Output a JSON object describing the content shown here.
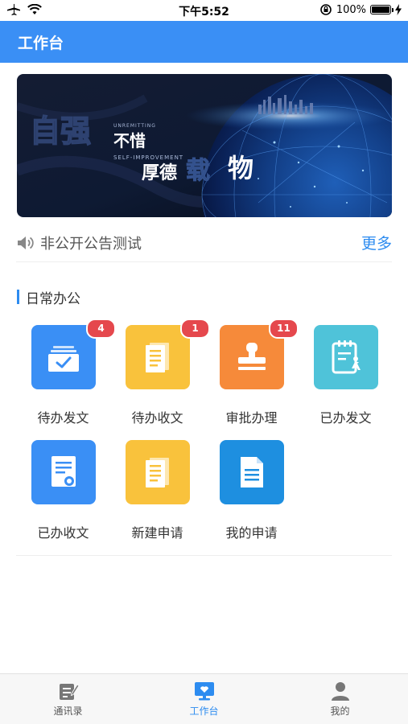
{
  "status_bar": {
    "time": "下午5:52",
    "battery_percent": "100%",
    "battery_level": 1.0
  },
  "header": {
    "title": "工作台"
  },
  "banner": {
    "text_zq": "自强",
    "text_unremitting": "UNREMITTING",
    "text_buxi": "不惜",
    "text_self_improvement": "SELF-IMPROVEMENT",
    "text_houde": "厚德",
    "text_zai": "载",
    "text_wu": "物"
  },
  "notice": {
    "text": "非公开公告测试",
    "more_label": "更多"
  },
  "section": {
    "title": "日常办公"
  },
  "apps": [
    {
      "label": "待办发文",
      "badge": "4",
      "icon": "inbox-check-icon",
      "color": "#3a8ff5"
    },
    {
      "label": "待办收文",
      "badge": "1",
      "icon": "document-icon",
      "color": "#f9c23c"
    },
    {
      "label": "审批办理",
      "badge": "11",
      "icon": "stamp-icon",
      "color": "#f68a3a"
    },
    {
      "label": "已办发文",
      "badge": "",
      "icon": "clipboard-person-icon",
      "color": "#4fc3d9"
    },
    {
      "label": "已办收文",
      "badge": "",
      "icon": "certificate-icon",
      "color": "#3a8ff5"
    },
    {
      "label": "新建申请",
      "badge": "",
      "icon": "document-icon",
      "color": "#f9c23c"
    },
    {
      "label": "我的申请",
      "badge": "",
      "icon": "file-lines-icon",
      "color": "#1e8fe0"
    }
  ],
  "tabs": [
    {
      "label": "通讯录",
      "icon": "contacts-icon",
      "active": false
    },
    {
      "label": "工作台",
      "icon": "workbench-icon",
      "active": true
    },
    {
      "label": "我的",
      "icon": "user-icon",
      "active": false
    }
  ],
  "colors": {
    "accent": "#2d8cf0",
    "header": "#3a8ff5",
    "badge": "#e5484d"
  }
}
